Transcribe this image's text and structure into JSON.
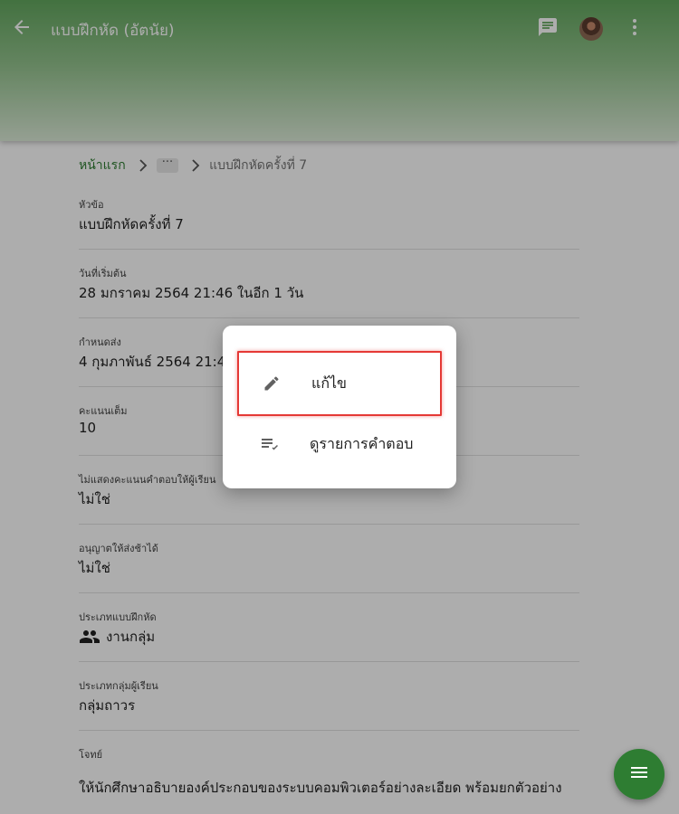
{
  "header": {
    "title": "แบบฝึกหัด (อัตนัย)",
    "back_icon": "arrow-back-icon",
    "chat_icon": "chat-icon",
    "more_icon": "more-vert-icon"
  },
  "breadcrumb": {
    "home": "หน้าแรก",
    "ellipsis": "···",
    "current": "แบบฝึกหัดครั้งที่ 7"
  },
  "fields": [
    {
      "label": "หัวข้อ",
      "value": "แบบฝึกหัดครั้งที่ 7"
    },
    {
      "label": "วันที่เริ่มต้น",
      "value": "28 มกราคม 2564 21:46 ในอีก 1 วัน"
    },
    {
      "label": "กำหนดส่ง",
      "value": "4 กุมภาพันธ์ 2564 21:46"
    },
    {
      "label": "คะแนนเต็ม",
      "value": "10"
    },
    {
      "label": "ไม่แสดงคะแนนคำตอบให้ผู้เรียน",
      "value": "ไม่ใช่"
    },
    {
      "label": "อนุญาตให้ส่งช้าได้",
      "value": "ไม่ใช่"
    },
    {
      "label": "ประเภทแบบฝึกหัด",
      "value": "งานกลุ่ม",
      "icon": "group-icon"
    },
    {
      "label": "ประเภทกลุ่มผู้เรียน",
      "value": "กลุ่มถาวร"
    },
    {
      "label": "โจทย์",
      "value": ""
    }
  ],
  "description": "ให้นักศึกษาอธิบายองค์ประกอบของระบบคอมพิวเตอร์อย่างละเอียด พร้อมยกตัวอย่าง",
  "menu": {
    "items": [
      {
        "label": "แก้ไข",
        "icon": "pencil-icon"
      },
      {
        "label": "ดูรายการคำตอบ",
        "icon": "playlist-check-icon"
      }
    ],
    "highlight_color": "#e53935"
  },
  "fab": {
    "icon": "menu-icon",
    "color": "#2e7d32"
  }
}
